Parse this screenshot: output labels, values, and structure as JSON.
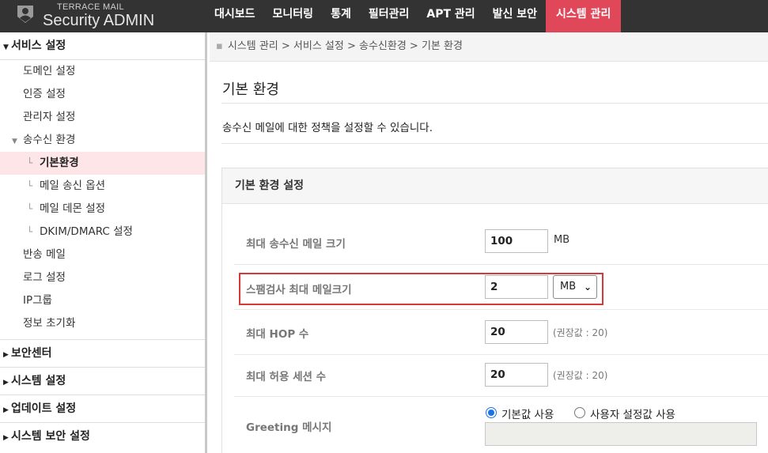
{
  "brand": {
    "small": "TERRACE MAIL",
    "big": "Security ADMIN"
  },
  "nav": [
    {
      "label": "대시보드"
    },
    {
      "label": "모니터링"
    },
    {
      "label": "통계"
    },
    {
      "label": "필터관리"
    },
    {
      "label": "APT 관리"
    },
    {
      "label": "발신 보안"
    },
    {
      "label": "시스템 관리",
      "active": true
    }
  ],
  "sidebar": {
    "section_title": "서비스 설정",
    "items": [
      {
        "label": "도메인 설정"
      },
      {
        "label": "인증 설정"
      },
      {
        "label": "관리자 설정"
      },
      {
        "label": "송수신 환경"
      },
      {
        "label": "기본환경"
      },
      {
        "label": "메일 송신 옵션"
      },
      {
        "label": "메일 데몬 설정"
      },
      {
        "label": "DKIM/DMARC 설정"
      },
      {
        "label": "반송 메일"
      },
      {
        "label": "로그 설정"
      },
      {
        "label": "IP그룹"
      },
      {
        "label": "정보 초기화"
      }
    ],
    "collapsed": [
      {
        "label": "보안센터"
      },
      {
        "label": "시스템 설정"
      },
      {
        "label": "업데이트 설정"
      },
      {
        "label": "시스템 보안 설정"
      }
    ]
  },
  "breadcrumb": "시스템 관리 > 서비스 설정 > 송수신환경 > 기본 환경",
  "page": {
    "title": "기본 환경",
    "description": "송수신 메일에 대한 정책을 설정할 수 있습니다."
  },
  "panel": {
    "title": "기본 환경 설정",
    "rows": [
      {
        "label": "최대 송수신 메일 크기",
        "value": "100",
        "unit": "MB"
      },
      {
        "label": "스팸검사 최대 메일크기",
        "value": "2",
        "unit_select": "MB"
      },
      {
        "label": "최대 HOP 수",
        "value": "20",
        "hint": "(권장값 : 20)"
      },
      {
        "label": "최대 허용 세션 수",
        "value": "20",
        "hint": "(권장값 : 20)"
      },
      {
        "label": "Greeting 메시지",
        "radio_default": "기본값 사용",
        "radio_custom": "사용자 설정값 사용",
        "selected": "default"
      }
    ]
  },
  "colors": {
    "topbar": "#333333",
    "active_nav": "#e0485a",
    "selected_item_bg": "#fde5e8",
    "highlight_border": "#d43a3a",
    "radio_accent": "#1a73e8"
  }
}
